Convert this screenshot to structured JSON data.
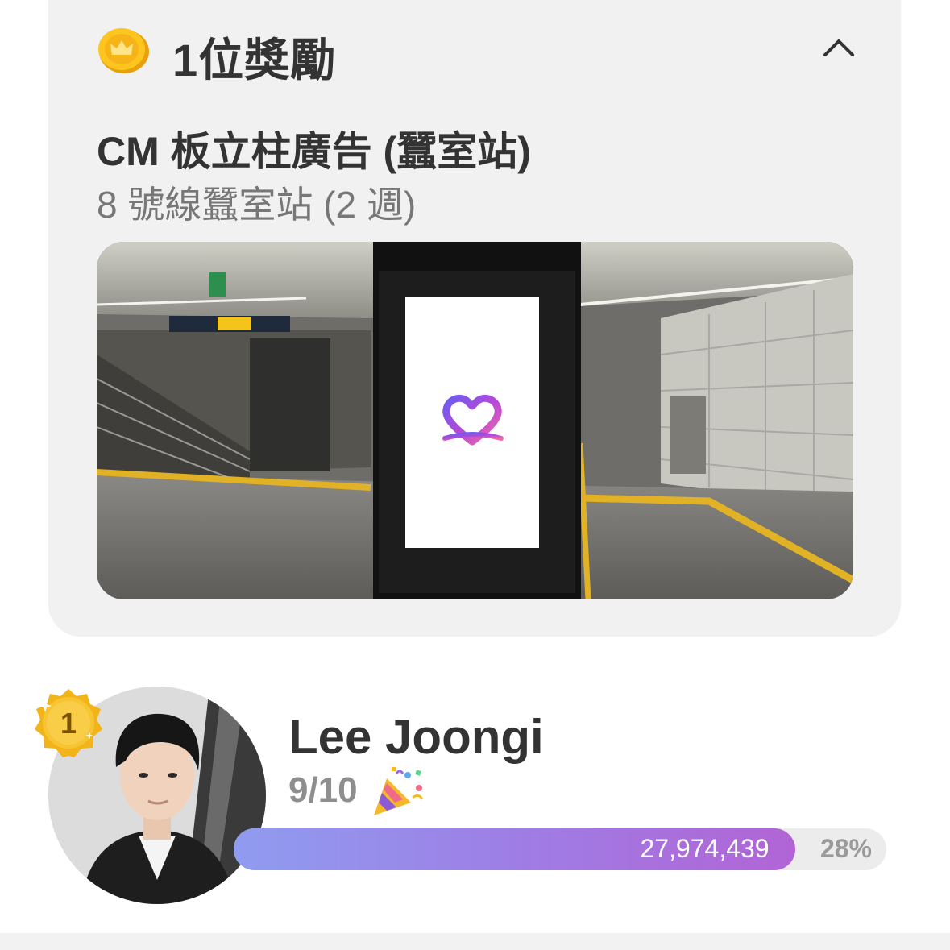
{
  "reward": {
    "icon": "crown-coin-icon",
    "title": "1位獎勵",
    "collapse_icon": "chevron-up-icon",
    "ad_title": "CM 板立柱廣告 (蠶室站)",
    "ad_subtitle": "8 號線蠶室站 (2 週)"
  },
  "ranking": {
    "rank": "1",
    "name": "Lee Joongi",
    "date": "9/10",
    "date_icon": "party-popper-icon",
    "votes": "27,974,439",
    "percent_label": "28%",
    "progress_fraction": 0.86
  },
  "colors": {
    "card_bg": "#f1f1f1",
    "title_text": "#333333",
    "subtitle_text": "#777777",
    "gold": "#f2b418",
    "progress_start": "#8f9cf0",
    "progress_end": "#b264d6"
  }
}
